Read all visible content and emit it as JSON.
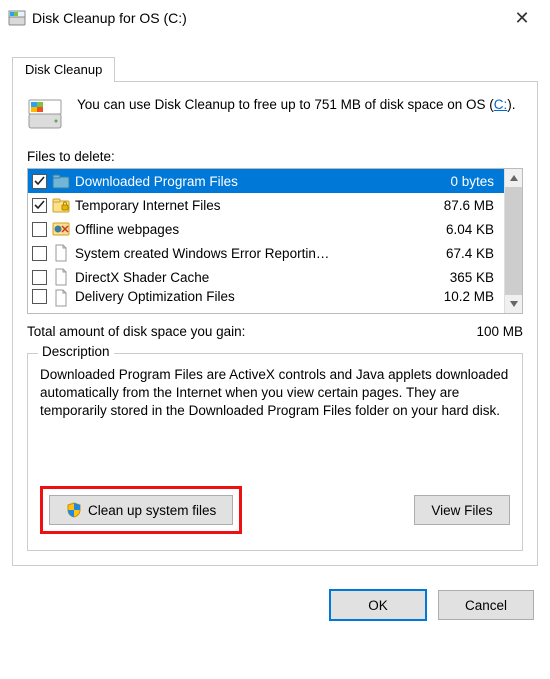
{
  "window": {
    "title": "Disk Cleanup for OS (C:)",
    "close_icon": "✕"
  },
  "tab": {
    "label": "Disk Cleanup"
  },
  "intro": {
    "pre": "You can use Disk Cleanup to free up to 751 MB of disk space on OS (",
    "link": "C:",
    "post": ")."
  },
  "files_label": "Files to delete:",
  "files": [
    {
      "checked": true,
      "name": "Downloaded Program Files",
      "size": "0 bytes",
      "selected": true,
      "icon": "folder-dl"
    },
    {
      "checked": true,
      "name": "Temporary Internet Files",
      "size": "87.6 MB",
      "selected": false,
      "icon": "lock-folder"
    },
    {
      "checked": false,
      "name": "Offline webpages",
      "size": "6.04 KB",
      "selected": false,
      "icon": "offline"
    },
    {
      "checked": false,
      "name": "System created Windows Error Reportin…",
      "size": "67.4 KB",
      "selected": false,
      "icon": "file"
    },
    {
      "checked": false,
      "name": "DirectX Shader Cache",
      "size": "365 KB",
      "selected": false,
      "icon": "file"
    },
    {
      "checked": false,
      "name": "Delivery Optimization Files",
      "size": "10.2 MB",
      "selected": false,
      "icon": "file",
      "clipped": true
    }
  ],
  "total": {
    "label": "Total amount of disk space you gain:",
    "value": "100 MB"
  },
  "description": {
    "legend": "Description",
    "text": "Downloaded Program Files are ActiveX controls and Java applets downloaded automatically from the Internet when you view certain pages. They are temporarily stored in the Downloaded Program Files folder on your hard disk."
  },
  "buttons": {
    "clean_system": "Clean up system files",
    "view_files": "View Files",
    "ok": "OK",
    "cancel": "Cancel"
  }
}
